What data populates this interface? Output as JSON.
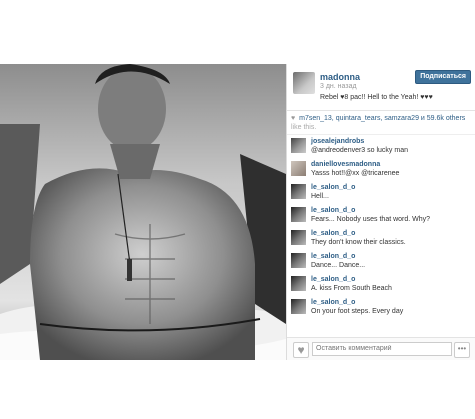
{
  "post": {
    "username": "madonna",
    "time_ago": "3 дн. назад",
    "follow_label": "Подписаться",
    "caption": "Rebel ♥8 pac!! Hell to the Yeah! ♥♥♥"
  },
  "likes": {
    "text": "m7sen_13, quintara_tears, samzara29 и 59.6k others",
    "sub": "like this."
  },
  "comments": [
    {
      "user": "josealejandrobs",
      "text": "@andreodenver3 so lucky man"
    },
    {
      "user": "daniellovesmadonna",
      "text": "Yasss hot!!@xx @tricarenee"
    },
    {
      "user": "le_salon_d_o",
      "text": "Hell..."
    },
    {
      "user": "le_salon_d_o",
      "text": "Fears... Nobody uses that word. Why?"
    },
    {
      "user": "le_salon_d_o",
      "text": "They don't know their classics."
    },
    {
      "user": "le_salon_d_o",
      "text": "Dance... Dance..."
    },
    {
      "user": "le_salon_d_o",
      "text": "A. kiss From South Beach"
    },
    {
      "user": "le_salon_d_o",
      "text": "On your foot steps. Every day"
    }
  ],
  "footer": {
    "comment_placeholder": "Оставить комментарий",
    "more_label": "•••"
  },
  "colors": {
    "link": "#2e5e86",
    "follow_button": "#3f729b"
  },
  "icons": {
    "like": "heart-icon",
    "more": "more-icon"
  }
}
